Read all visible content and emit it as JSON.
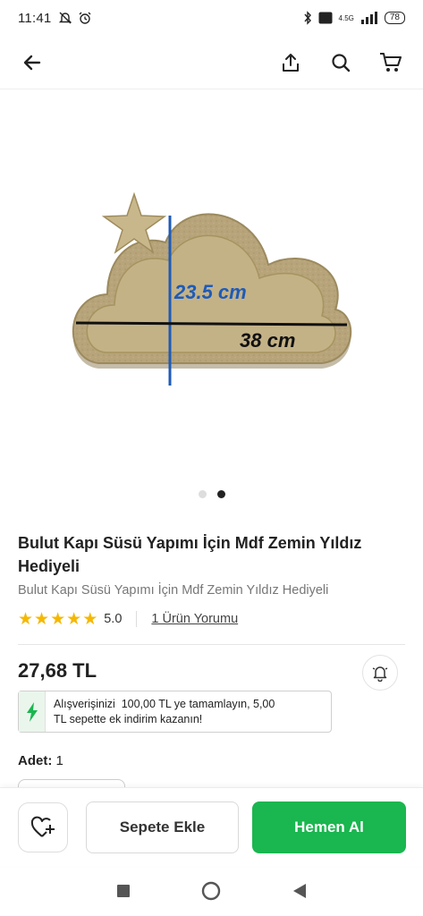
{
  "status_bar": {
    "time": "11:41",
    "battery": "78",
    "network": "4.5G"
  },
  "product": {
    "title": "Bulut Kapı Süsü Yapımı İçin Mdf Zemin Yıldız Hediyeli",
    "subtitle": "Bulut Kapı Süsü Yapımı İçin Mdf Zemin Yıldız Hediyeli",
    "rating": "5.0",
    "stars": 5,
    "reviews_link": "1 Ürün Yorumu",
    "price": "27,68 TL",
    "image_labels": {
      "height": "23.5 cm",
      "width": "38 cm"
    },
    "gallery": {
      "total": 2,
      "active": 2
    }
  },
  "promo": {
    "line1": "Alışverişinizi  100,00 TL ye tamamlayın, 5,00",
    "line2": "TL sepette ek indirim kazanın!"
  },
  "quantity": {
    "label": "Adet:",
    "value": "1"
  },
  "actions": {
    "add_to_cart": "Sepete Ekle",
    "buy_now": "Hemen Al"
  },
  "colors": {
    "accent_green": "#1ab64f",
    "star": "#f5b800",
    "dimension_blue": "#1e5bb8"
  }
}
